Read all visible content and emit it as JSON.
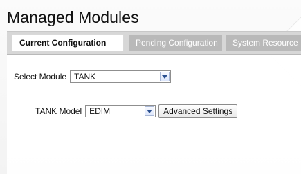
{
  "page": {
    "title": "Managed Modules"
  },
  "tabs": [
    {
      "label": "Current Configuration"
    },
    {
      "label": "Pending Configuration"
    },
    {
      "label": "System Resource"
    }
  ],
  "module_select": {
    "label": "Select Module",
    "value": "TANK",
    "icon": "chevron-down-icon"
  },
  "model_select": {
    "label": "TANK Model",
    "value": "EDIM",
    "icon": "chevron-down-icon"
  },
  "advanced_button": {
    "label": "Advanced Settings"
  }
}
